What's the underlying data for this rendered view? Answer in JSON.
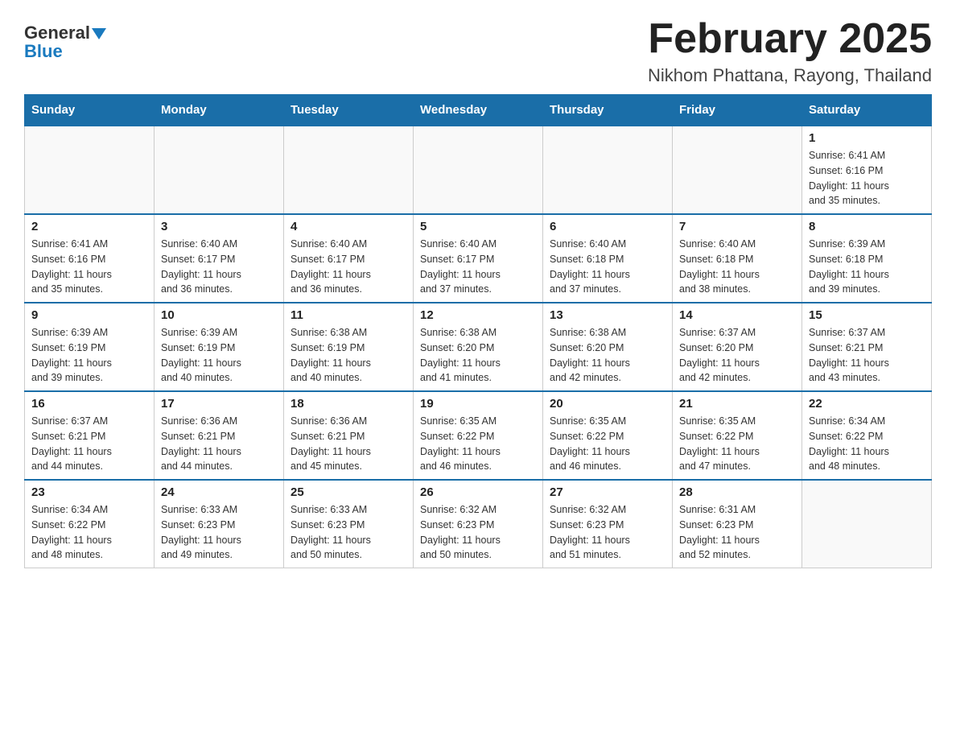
{
  "header": {
    "logo_general": "General",
    "logo_blue": "Blue",
    "month_title": "February 2025",
    "location": "Nikhom Phattana, Rayong, Thailand"
  },
  "weekdays": [
    "Sunday",
    "Monday",
    "Tuesday",
    "Wednesday",
    "Thursday",
    "Friday",
    "Saturday"
  ],
  "weeks": [
    [
      {
        "day": "",
        "info": ""
      },
      {
        "day": "",
        "info": ""
      },
      {
        "day": "",
        "info": ""
      },
      {
        "day": "",
        "info": ""
      },
      {
        "day": "",
        "info": ""
      },
      {
        "day": "",
        "info": ""
      },
      {
        "day": "1",
        "info": "Sunrise: 6:41 AM\nSunset: 6:16 PM\nDaylight: 11 hours\nand 35 minutes."
      }
    ],
    [
      {
        "day": "2",
        "info": "Sunrise: 6:41 AM\nSunset: 6:16 PM\nDaylight: 11 hours\nand 35 minutes."
      },
      {
        "day": "3",
        "info": "Sunrise: 6:40 AM\nSunset: 6:17 PM\nDaylight: 11 hours\nand 36 minutes."
      },
      {
        "day": "4",
        "info": "Sunrise: 6:40 AM\nSunset: 6:17 PM\nDaylight: 11 hours\nand 36 minutes."
      },
      {
        "day": "5",
        "info": "Sunrise: 6:40 AM\nSunset: 6:17 PM\nDaylight: 11 hours\nand 37 minutes."
      },
      {
        "day": "6",
        "info": "Sunrise: 6:40 AM\nSunset: 6:18 PM\nDaylight: 11 hours\nand 37 minutes."
      },
      {
        "day": "7",
        "info": "Sunrise: 6:40 AM\nSunset: 6:18 PM\nDaylight: 11 hours\nand 38 minutes."
      },
      {
        "day": "8",
        "info": "Sunrise: 6:39 AM\nSunset: 6:18 PM\nDaylight: 11 hours\nand 39 minutes."
      }
    ],
    [
      {
        "day": "9",
        "info": "Sunrise: 6:39 AM\nSunset: 6:19 PM\nDaylight: 11 hours\nand 39 minutes."
      },
      {
        "day": "10",
        "info": "Sunrise: 6:39 AM\nSunset: 6:19 PM\nDaylight: 11 hours\nand 40 minutes."
      },
      {
        "day": "11",
        "info": "Sunrise: 6:38 AM\nSunset: 6:19 PM\nDaylight: 11 hours\nand 40 minutes."
      },
      {
        "day": "12",
        "info": "Sunrise: 6:38 AM\nSunset: 6:20 PM\nDaylight: 11 hours\nand 41 minutes."
      },
      {
        "day": "13",
        "info": "Sunrise: 6:38 AM\nSunset: 6:20 PM\nDaylight: 11 hours\nand 42 minutes."
      },
      {
        "day": "14",
        "info": "Sunrise: 6:37 AM\nSunset: 6:20 PM\nDaylight: 11 hours\nand 42 minutes."
      },
      {
        "day": "15",
        "info": "Sunrise: 6:37 AM\nSunset: 6:21 PM\nDaylight: 11 hours\nand 43 minutes."
      }
    ],
    [
      {
        "day": "16",
        "info": "Sunrise: 6:37 AM\nSunset: 6:21 PM\nDaylight: 11 hours\nand 44 minutes."
      },
      {
        "day": "17",
        "info": "Sunrise: 6:36 AM\nSunset: 6:21 PM\nDaylight: 11 hours\nand 44 minutes."
      },
      {
        "day": "18",
        "info": "Sunrise: 6:36 AM\nSunset: 6:21 PM\nDaylight: 11 hours\nand 45 minutes."
      },
      {
        "day": "19",
        "info": "Sunrise: 6:35 AM\nSunset: 6:22 PM\nDaylight: 11 hours\nand 46 minutes."
      },
      {
        "day": "20",
        "info": "Sunrise: 6:35 AM\nSunset: 6:22 PM\nDaylight: 11 hours\nand 46 minutes."
      },
      {
        "day": "21",
        "info": "Sunrise: 6:35 AM\nSunset: 6:22 PM\nDaylight: 11 hours\nand 47 minutes."
      },
      {
        "day": "22",
        "info": "Sunrise: 6:34 AM\nSunset: 6:22 PM\nDaylight: 11 hours\nand 48 minutes."
      }
    ],
    [
      {
        "day": "23",
        "info": "Sunrise: 6:34 AM\nSunset: 6:22 PM\nDaylight: 11 hours\nand 48 minutes."
      },
      {
        "day": "24",
        "info": "Sunrise: 6:33 AM\nSunset: 6:23 PM\nDaylight: 11 hours\nand 49 minutes."
      },
      {
        "day": "25",
        "info": "Sunrise: 6:33 AM\nSunset: 6:23 PM\nDaylight: 11 hours\nand 50 minutes."
      },
      {
        "day": "26",
        "info": "Sunrise: 6:32 AM\nSunset: 6:23 PM\nDaylight: 11 hours\nand 50 minutes."
      },
      {
        "day": "27",
        "info": "Sunrise: 6:32 AM\nSunset: 6:23 PM\nDaylight: 11 hours\nand 51 minutes."
      },
      {
        "day": "28",
        "info": "Sunrise: 6:31 AM\nSunset: 6:23 PM\nDaylight: 11 hours\nand 52 minutes."
      },
      {
        "day": "",
        "info": ""
      }
    ]
  ]
}
